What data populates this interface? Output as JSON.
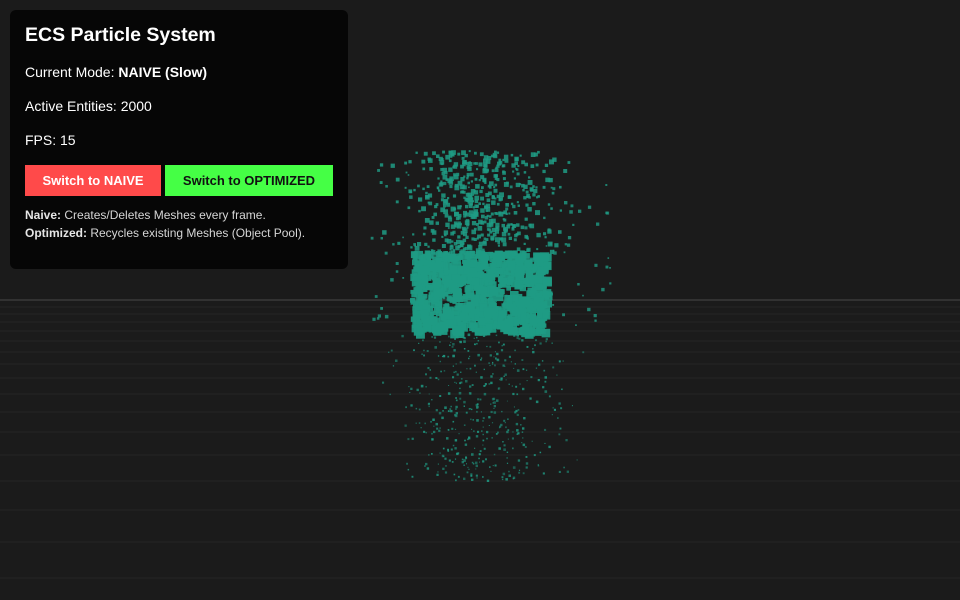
{
  "panel": {
    "title": "ECS Particle System",
    "mode_label": "Current Mode: ",
    "mode_value": "NAIVE (Slow)",
    "entities_label": "Active Entities: ",
    "entities_value": "2000",
    "fps_label": "FPS: ",
    "fps_value": "15",
    "btn_naive": "Switch to NAIVE",
    "btn_optimized": "Switch to OPTIMIZED",
    "note_naive_label": "Naive:",
    "note_naive_text": " Creates/Deletes Meshes every frame.",
    "note_opt_label": "Optimized:",
    "note_opt_text": " Recycles existing Meshes (Object Pool)."
  },
  "colors": {
    "background": "#1b1b1b",
    "panel": "#060606",
    "particle": "#1f9b84",
    "naive_button": "#ff4a4a",
    "optimized_button": "#45ff45"
  }
}
